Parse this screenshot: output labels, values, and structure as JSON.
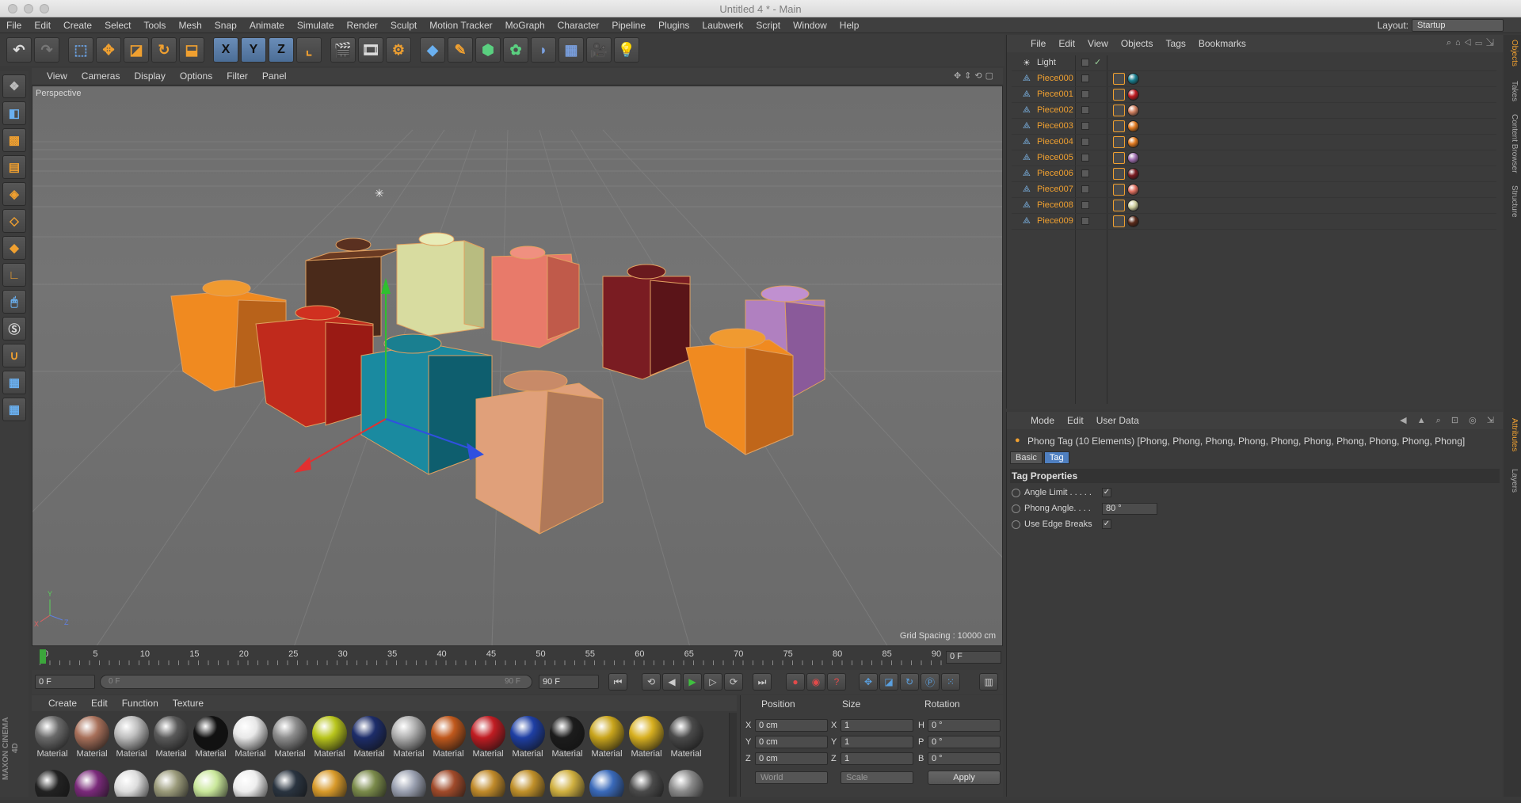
{
  "window": {
    "title": "Untitled 4 * - Main"
  },
  "menubar": {
    "items": [
      "File",
      "Edit",
      "Create",
      "Select",
      "Tools",
      "Mesh",
      "Snap",
      "Animate",
      "Simulate",
      "Render",
      "Sculpt",
      "Motion Tracker",
      "MoGraph",
      "Character",
      "Pipeline",
      "Plugins",
      "Laubwerk",
      "Script",
      "Window",
      "Help"
    ],
    "layout_label": "Layout:",
    "layout_value": "Startup"
  },
  "toolbar": {
    "axis_x": "X",
    "axis_y": "Y",
    "axis_z": "Z"
  },
  "viewport": {
    "menu": [
      "View",
      "Cameras",
      "Display",
      "Options",
      "Filter",
      "Panel"
    ],
    "label": "Perspective",
    "grid_spacing": "Grid Spacing : 10000 cm"
  },
  "timeline": {
    "marks": [
      "0",
      "5",
      "10",
      "15",
      "20",
      "25",
      "30",
      "35",
      "40",
      "45",
      "50",
      "55",
      "60",
      "65",
      "70",
      "75",
      "80",
      "85",
      "90"
    ],
    "end_frame": "0 F",
    "current_frame": "0 F",
    "range_start": "0 F",
    "range_end": "90 F",
    "max_frame": "90 F"
  },
  "material_manager": {
    "menu": [
      "Create",
      "Edit",
      "Function",
      "Texture"
    ],
    "materials": [
      {
        "name": "Material",
        "color": "#6a6a6a"
      },
      {
        "name": "Material",
        "color": "#a8705a"
      },
      {
        "name": "Material",
        "color": "#bdbdbd"
      },
      {
        "name": "Material",
        "color": "#5a5a5a"
      },
      {
        "name": "Material",
        "color": "#111111"
      },
      {
        "name": "Material",
        "color": "#e8e8e8"
      },
      {
        "name": "Material",
        "color": "#8d8d8d"
      },
      {
        "name": "Material",
        "color": "#b8c51c"
      },
      {
        "name": "Material",
        "color": "#1d2d6a"
      },
      {
        "name": "Material",
        "color": "#b0b0b0"
      },
      {
        "name": "Material",
        "color": "#c0581c"
      },
      {
        "name": "Material",
        "color": "#c01c22"
      },
      {
        "name": "Material",
        "color": "#1e3fa4"
      },
      {
        "name": "Material",
        "color": "#1c1c1c"
      },
      {
        "name": "Material",
        "color": "#c9a51c"
      },
      {
        "name": "Material",
        "color": "#d8b020"
      },
      {
        "name": "Material",
        "color": "#4a4a4a"
      }
    ],
    "second_row_colors": [
      "#222222",
      "#7a2a7a",
      "#dddddd",
      "#9a9a7a",
      "#c9e79a",
      "#eeeeee",
      "#2a3440",
      "#d89a2a",
      "#7a8a4a",
      "#9aa0b0",
      "#a04a2a",
      "#c08a2a",
      "#c0902a",
      "#d0b040",
      "#3a6aba",
      "#4a4a4a",
      "#8a8a8a"
    ]
  },
  "coordinates": {
    "headers": {
      "position": "Position",
      "size": "Size",
      "rotation": "Rotation"
    },
    "rows": [
      {
        "axis": "X",
        "pos": "0 cm",
        "size_axis": "X",
        "size": "1",
        "rot_axis": "H",
        "rot": "0 °"
      },
      {
        "axis": "Y",
        "pos": "0 cm",
        "size_axis": "Y",
        "size": "1",
        "rot_axis": "P",
        "rot": "0 °"
      },
      {
        "axis": "Z",
        "pos": "0 cm",
        "size_axis": "Z",
        "size": "1",
        "rot_axis": "B",
        "rot": "0 °"
      }
    ],
    "space": "World",
    "mode": "Scale",
    "apply": "Apply"
  },
  "object_manager": {
    "menu": [
      "File",
      "Edit",
      "View",
      "Objects",
      "Tags",
      "Bookmarks"
    ],
    "objects": [
      {
        "name": "Light",
        "type": "light",
        "tag_color": ""
      },
      {
        "name": "Piece000",
        "type": "mesh",
        "tag_color": "#1a7f90"
      },
      {
        "name": "Piece001",
        "type": "mesh",
        "tag_color": "#c01c22"
      },
      {
        "name": "Piece002",
        "type": "mesh",
        "tag_color": "#d08060"
      },
      {
        "name": "Piece003",
        "type": "mesh",
        "tag_color": "#e07a20"
      },
      {
        "name": "Piece004",
        "type": "mesh",
        "tag_color": "#e07a20"
      },
      {
        "name": "Piece005",
        "type": "mesh",
        "tag_color": "#a070b0"
      },
      {
        "name": "Piece006",
        "type": "mesh",
        "tag_color": "#7a1c22"
      },
      {
        "name": "Piece007",
        "type": "mesh",
        "tag_color": "#e07060"
      },
      {
        "name": "Piece008",
        "type": "mesh",
        "tag_color": "#d0d0a0"
      },
      {
        "name": "Piece009",
        "type": "mesh",
        "tag_color": "#5a2a1a"
      }
    ]
  },
  "attribute_manager": {
    "menu": [
      "Mode",
      "Edit",
      "User Data"
    ],
    "title": "Phong Tag (10 Elements) [Phong, Phong, Phong, Phong, Phong, Phong, Phong, Phong, Phong, Phong]",
    "tabs": [
      "Basic",
      "Tag"
    ],
    "section": "Tag Properties",
    "props": [
      {
        "label": "Angle Limit . . . . .",
        "value": "✓",
        "kind": "check"
      },
      {
        "label": "Phong Angle. . . .",
        "value": "80 °",
        "kind": "field"
      },
      {
        "label": "Use Edge Breaks",
        "value": "✓",
        "kind": "check"
      }
    ]
  },
  "side_tabs": {
    "top": [
      "Objects",
      "Takes",
      "Content Browser",
      "Structure"
    ],
    "bottom": [
      "Attributes",
      "Layers"
    ]
  },
  "brand": "MAXON CINEMA 4D"
}
